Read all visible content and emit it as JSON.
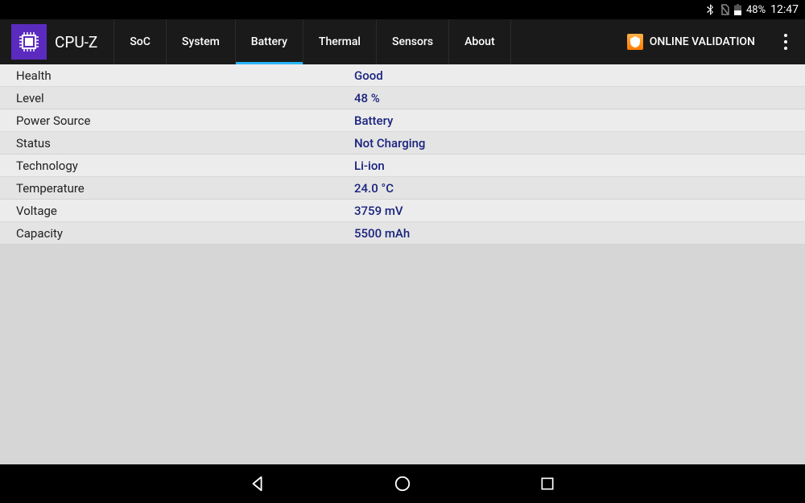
{
  "status_bar": {
    "battery_pct": "48%",
    "clock": "12:47"
  },
  "app": {
    "title": "CPU-Z"
  },
  "tabs": [
    {
      "label": "SoC",
      "active": false
    },
    {
      "label": "System",
      "active": false
    },
    {
      "label": "Battery",
      "active": true
    },
    {
      "label": "Thermal",
      "active": false
    },
    {
      "label": "Sensors",
      "active": false
    },
    {
      "label": "About",
      "active": false
    }
  ],
  "validation_label": "ONLINE VALIDATION",
  "rows": [
    {
      "label": "Health",
      "value": "Good"
    },
    {
      "label": "Level",
      "value": "48 %"
    },
    {
      "label": "Power Source",
      "value": "Battery"
    },
    {
      "label": "Status",
      "value": "Not Charging"
    },
    {
      "label": "Technology",
      "value": "Li-ion"
    },
    {
      "label": "Temperature",
      "value": "24.0 °C"
    },
    {
      "label": "Voltage",
      "value": "3759 mV"
    },
    {
      "label": "Capacity",
      "value": "5500 mAh"
    }
  ]
}
